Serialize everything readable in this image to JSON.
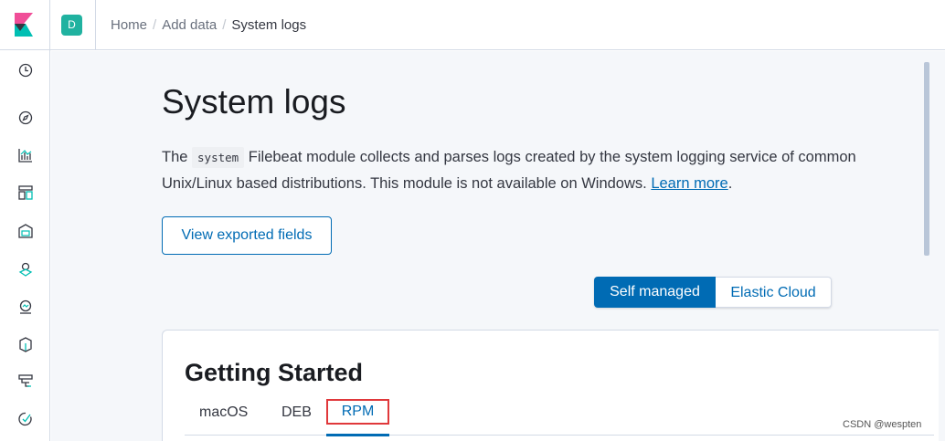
{
  "header": {
    "space_initial": "D",
    "breadcrumbs": [
      "Home",
      "Add data",
      "System logs"
    ]
  },
  "sidebar": {
    "items": [
      "clock-icon",
      "compass-icon",
      "visualize-icon",
      "dashboard-icon",
      "canvas-icon",
      "maps-icon",
      "ml-icon",
      "infrastructure-icon",
      "logs-icon",
      "uptime-icon"
    ]
  },
  "main": {
    "title": "System logs",
    "desc_pre": "The",
    "desc_code": "system",
    "desc_post": "Filebeat module collects and parses logs created by the system logging service of common Unix/Linux based distributions. This module is not available on Windows.",
    "learn_more": "Learn more",
    "desc_end": ".",
    "view_fields_button": "View exported fields",
    "toggle": {
      "self_managed": "Self managed",
      "elastic_cloud": "Elastic Cloud",
      "selected": "Self managed"
    },
    "getting_started": {
      "title": "Getting Started",
      "tabs": [
        "macOS",
        "DEB",
        "RPM"
      ],
      "selected_tab": "RPM"
    }
  },
  "watermark": "CSDN @wespten",
  "colors": {
    "accent": "#006bb4",
    "space_avatar": "#20b2a0",
    "highlight_box": "#e0383b"
  }
}
